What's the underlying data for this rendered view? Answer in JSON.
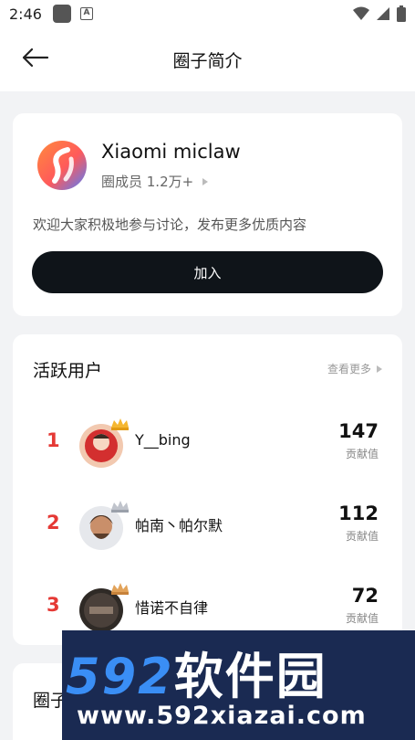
{
  "status_bar": {
    "time": "2:46"
  },
  "header": {
    "title": "圈子简介"
  },
  "circle": {
    "name": "Xiaomi miclaw",
    "members": "圈成员 1.2万+",
    "description": "欢迎大家积极地参与讨论，发布更多优质内容",
    "join_label": "加入"
  },
  "active_users": {
    "title": "活跃用户",
    "see_more": "查看更多",
    "score_label": "贡献值",
    "users": [
      {
        "rank": "1",
        "name": "Y__bing",
        "score": "147"
      },
      {
        "rank": "2",
        "name": "帕南丶帕尔默",
        "score": "112"
      },
      {
        "rank": "3",
        "name": "惜诺不自律",
        "score": "72"
      }
    ]
  },
  "next_section": {
    "title": "圈子"
  },
  "watermark": {
    "big_digits": "592",
    "big_text": "软件园",
    "url": "www.592xiazai.com"
  },
  "colors": {
    "rank": "#e53935",
    "join_button": "#0f1419",
    "watermark_bg": "#1a2a52",
    "watermark_accent": "#3a8ef5"
  }
}
